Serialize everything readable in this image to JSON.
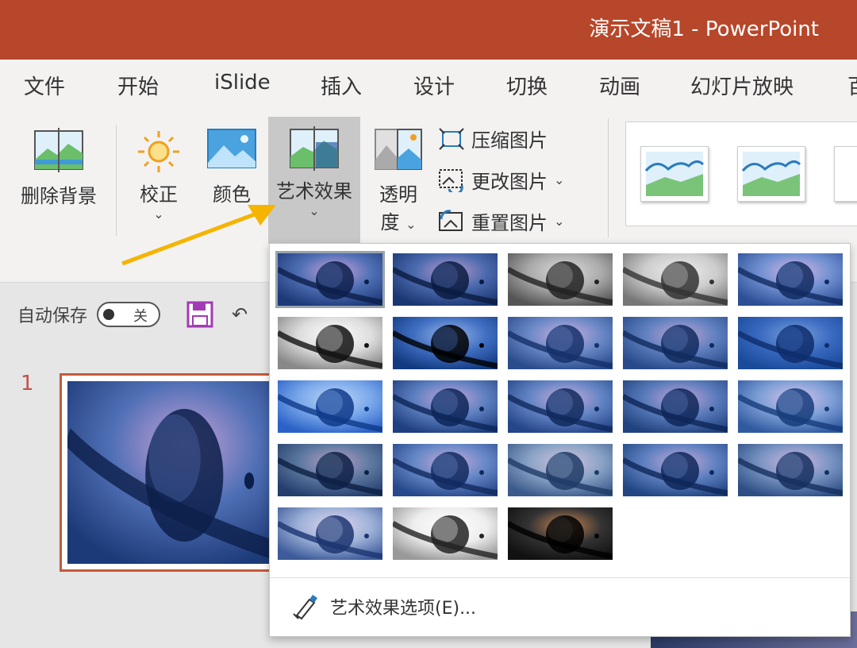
{
  "titlebar": {
    "title": "演示文稿1  -  PowerPoint",
    "color": "#b7472a"
  },
  "tabs": [
    {
      "label": "文件"
    },
    {
      "label": "开始"
    },
    {
      "label": "iSlide"
    },
    {
      "label": "插入"
    },
    {
      "label": "设计"
    },
    {
      "label": "切换"
    },
    {
      "label": "动画"
    },
    {
      "label": "幻灯片放映"
    },
    {
      "label": "百"
    }
  ],
  "ribbon": {
    "remove_bg": "删除背景",
    "corrections": "校正",
    "color": "颜色",
    "artistic": "艺术效果",
    "transparency_line1": "透明",
    "transparency_line2": "度",
    "compress": "压缩图片",
    "change": "更改图片",
    "reset": "重置图片"
  },
  "qat": {
    "autosave_label": "自动保存",
    "toggle_state": "关"
  },
  "slides": [
    {
      "number": "1"
    }
  ],
  "dropdown": {
    "effects_count": 23,
    "selected_index": 0,
    "options_label": "艺术效果选项(E)..."
  },
  "colors": {
    "accent": "#b7472a",
    "arrow": "#f5b400",
    "selection": "#c55a3a"
  }
}
